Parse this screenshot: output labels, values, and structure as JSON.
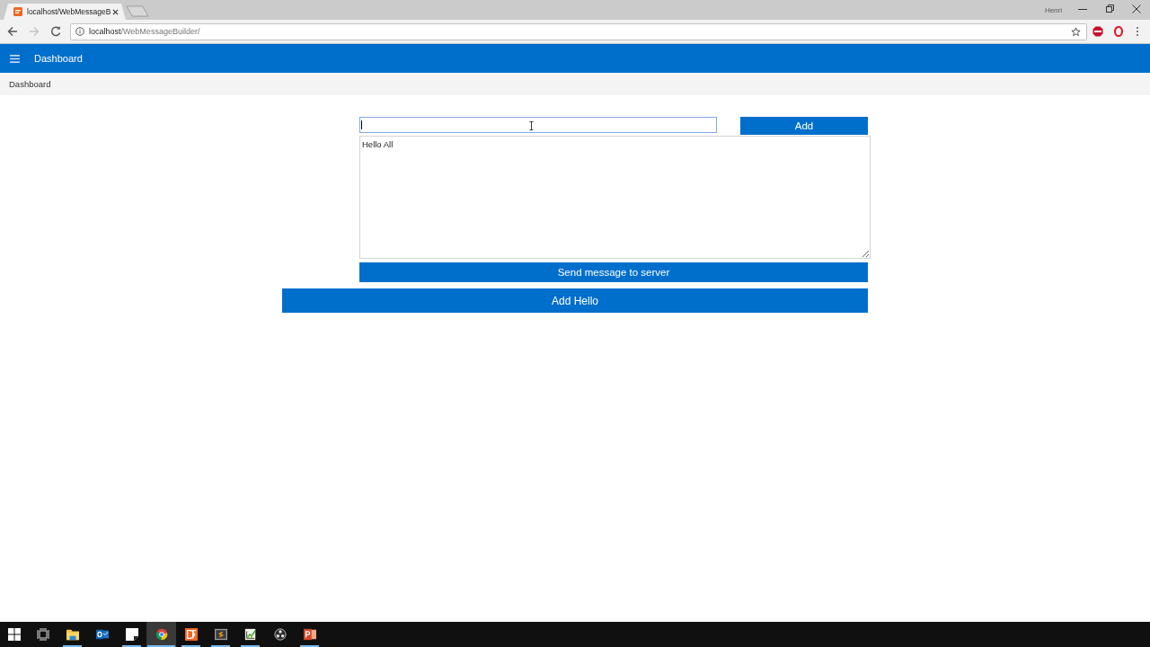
{
  "browser": {
    "tabs": [
      {
        "title": "localhost/WebMessageB",
        "selected": true
      }
    ],
    "user": "Henri",
    "nav": [
      {
        "kind": "back",
        "disabled": false
      },
      {
        "kind": "forward",
        "disabled": true
      },
      {
        "kind": "reload",
        "disabled": false
      }
    ],
    "address": {
      "host": "localhost",
      "path": "/WebMessageBuilder/"
    },
    "extensions": [
      {
        "kind": "stop-sign"
      },
      {
        "kind": "ring"
      }
    ]
  },
  "app_bar": {
    "title": "Dashboard"
  },
  "breadcrumb": [
    {
      "label": "Dashboard"
    }
  ],
  "form": {
    "text_field": {
      "focused": true
    },
    "add_button": "Add",
    "message_area": {
      "value": "Hello All"
    },
    "send_button": "Send message to server",
    "hello_button": "Add Hello"
  },
  "taskbar": {
    "apps": [
      {
        "kind": "explorer",
        "running": true,
        "selected": false
      },
      {
        "kind": "mail",
        "running": false,
        "selected": false
      },
      {
        "kind": "note",
        "running": true,
        "selected": false
      },
      {
        "kind": "browser",
        "running": true,
        "selected": true
      },
      {
        "kind": "tile",
        "running": true,
        "selected": false
      },
      {
        "kind": "editor",
        "running": true,
        "selected": false
      },
      {
        "kind": "chart",
        "running": true,
        "selected": false
      },
      {
        "kind": "disc",
        "running": false,
        "selected": false
      },
      {
        "kind": "slides",
        "running": true,
        "selected": false
      }
    ]
  }
}
